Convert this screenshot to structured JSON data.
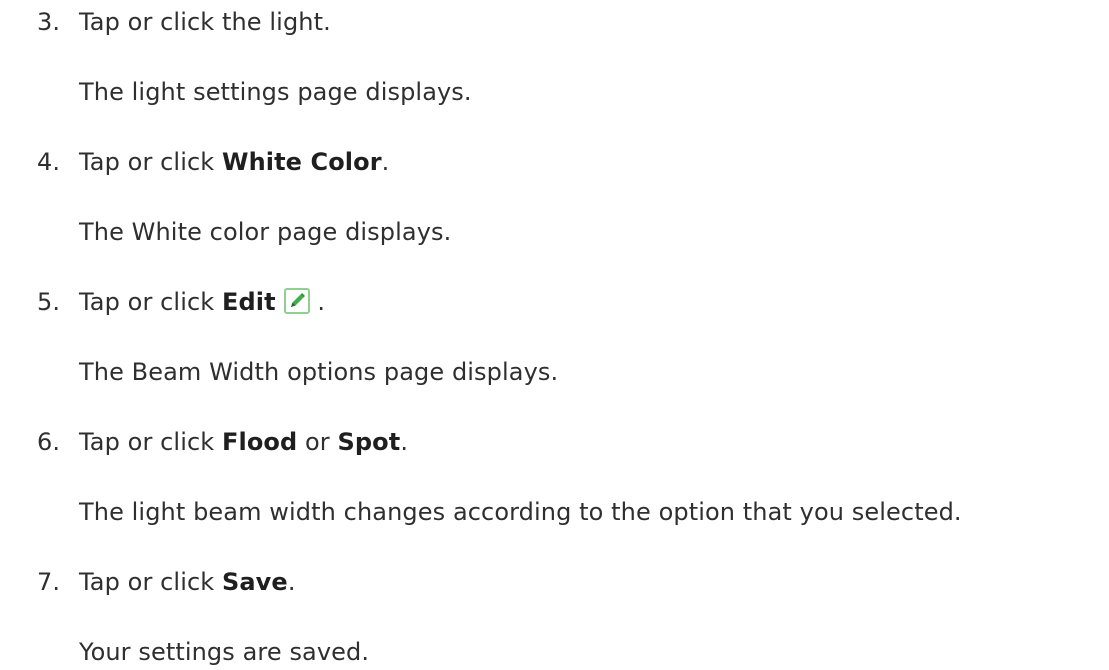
{
  "steps": [
    {
      "number": "3.",
      "instruction": "Tap or click the light.",
      "result": "The light settings page displays."
    },
    {
      "number": "4.",
      "prefix": "Tap or click ",
      "target": "White Color",
      "suffix": ".",
      "result": "The White color page displays."
    },
    {
      "number": "5.",
      "prefix": "Tap or click ",
      "target": "Edit",
      "icon": "edit-pencil-icon",
      "suffix": " .",
      "result": "The Beam Width options page displays."
    },
    {
      "number": "6.",
      "prefix": "Tap or click ",
      "target": "Flood",
      "middle": " or ",
      "target2": "Spot",
      "suffix": ".",
      "result": "The light beam width changes according to the option that you selected."
    },
    {
      "number": "7.",
      "prefix": "Tap or click ",
      "target": "Save",
      "suffix": ".",
      "result": "Your settings are saved."
    }
  ],
  "colors": {
    "text": "#2f2f2f",
    "icon_green": "#3fae4a",
    "icon_border": "#8fd08f"
  }
}
